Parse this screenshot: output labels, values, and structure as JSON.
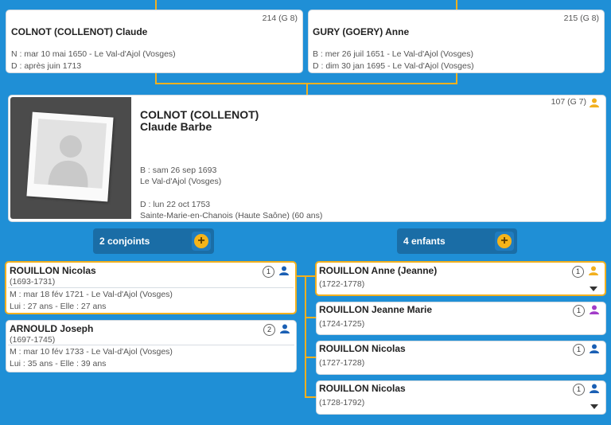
{
  "colors": {
    "background": "#1f8fd6",
    "connector": "#f2b01e",
    "female": "#f2b01e",
    "male": "#1a5fb4",
    "pill": "#1a6da6"
  },
  "father": {
    "name": "COLNOT (COLLENOT) Claude",
    "sosa": "214 (G 8)",
    "birth": "N : mar 10 mai 1650 - Le Val-d'Ajol (Vosges)",
    "death": "D : après juin 1713"
  },
  "mother": {
    "name": "GURY (GOERY) Anne",
    "sosa": "215 (G 8)",
    "birth": "B : mer 26 juil 1651 - Le Val-d'Ajol (Vosges)",
    "death": "D : dim 30 jan 1695 - Le Val-d'Ajol (Vosges)"
  },
  "main": {
    "surname": "COLNOT (COLLENOT)",
    "given": "Claude Barbe",
    "sosa": "107 (G 7)",
    "birth_date": "B : sam 26 sep 1693",
    "birth_place": "Le Val-d'Ajol (Vosges)",
    "death_date": "D : lun 22 oct 1753",
    "death_place": "Sainte-Marie-en-Chanois (Haute Saône) (60 ans)",
    "photo_icon": "user-silhouette-placeholder"
  },
  "spouses_pill": {
    "label": "2 conjoints",
    "icon": "plus-icon"
  },
  "children_pill": {
    "label": "4 enfants",
    "icon": "plus-icon"
  },
  "spouses": [
    {
      "name": "ROUILLON Nicolas",
      "years": "(1693-1731)",
      "num": "1",
      "marriage": "M : mar 18 fév 1721 - Le Val-d'Ajol (Vosges)",
      "ages": "Lui : 27 ans - Elle : 27 ans"
    },
    {
      "name": "ARNOULD Joseph",
      "years": "(1697-1745)",
      "num": "2",
      "marriage": "M : mar 10 fév 1733 - Le Val-d'Ajol (Vosges)",
      "ages": "Lui : 35 ans - Elle : 39 ans"
    }
  ],
  "children": [
    {
      "name": "ROUILLON Anne (Jeanne)",
      "years": "(1722-1778)",
      "num": "1"
    },
    {
      "name": "ROUILLON Jeanne Marie",
      "years": "(1724-1725)",
      "num": "1"
    },
    {
      "name": "ROUILLON Nicolas",
      "years": "(1727-1728)",
      "num": "1"
    },
    {
      "name": "ROUILLON Nicolas",
      "years": "(1728-1792)",
      "num": "1"
    }
  ]
}
